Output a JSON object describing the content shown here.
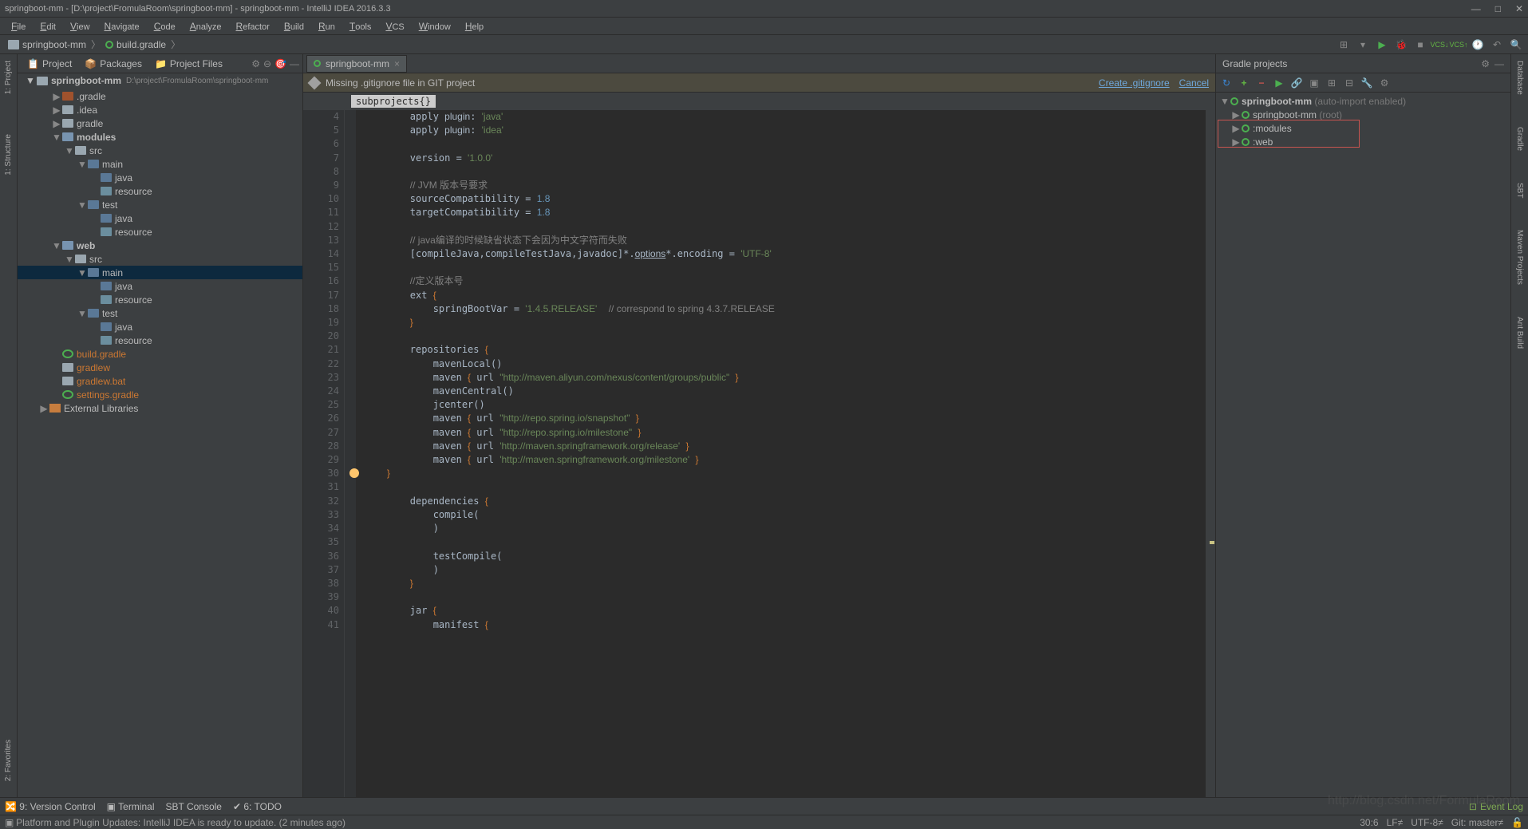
{
  "titlebar": "springboot-mm - [D:\\project\\FromulaRoom\\springboot-mm] - springboot-mm - IntelliJ IDEA 2016.3.3",
  "menu": [
    "File",
    "Edit",
    "View",
    "Navigate",
    "Code",
    "Analyze",
    "Refactor",
    "Build",
    "Run",
    "Tools",
    "VCS",
    "Window",
    "Help"
  ],
  "breadcrumb": {
    "proj": "springboot-mm",
    "file": "build.gradle"
  },
  "panelTabs": [
    "Project",
    "Packages",
    "Project Files"
  ],
  "projHeader": {
    "name": "springboot-mm",
    "path": "D:\\project\\FromulaRoom\\springboot-mm"
  },
  "tree": [
    {
      "d": 1,
      "c": "▶",
      "t": "excl",
      "l": ".gradle"
    },
    {
      "d": 1,
      "c": "▶",
      "t": "folder",
      "l": ".idea"
    },
    {
      "d": 1,
      "c": "▶",
      "t": "folder",
      "l": "gradle"
    },
    {
      "d": 1,
      "c": "▼",
      "t": "modfolder",
      "l": "modules",
      "b": true
    },
    {
      "d": 2,
      "c": "▼",
      "t": "folder",
      "l": "src"
    },
    {
      "d": 3,
      "c": "▼",
      "t": "srcfolder",
      "l": "main"
    },
    {
      "d": 4,
      "c": "",
      "t": "srcfolder",
      "l": "java"
    },
    {
      "d": 4,
      "c": "",
      "t": "resfolder",
      "l": "resource"
    },
    {
      "d": 3,
      "c": "▼",
      "t": "srcfolder",
      "l": "test"
    },
    {
      "d": 4,
      "c": "",
      "t": "srcfolder",
      "l": "java"
    },
    {
      "d": 4,
      "c": "",
      "t": "resfolder",
      "l": "resource"
    },
    {
      "d": 1,
      "c": "▼",
      "t": "modfolder",
      "l": "web",
      "b": true
    },
    {
      "d": 2,
      "c": "▼",
      "t": "folder",
      "l": "src"
    },
    {
      "d": 3,
      "c": "▼",
      "t": "srcfolder",
      "l": "main",
      "sel": true
    },
    {
      "d": 4,
      "c": "",
      "t": "srcfolder",
      "l": "java"
    },
    {
      "d": 4,
      "c": "",
      "t": "resfolder",
      "l": "resource"
    },
    {
      "d": 3,
      "c": "▼",
      "t": "srcfolder",
      "l": "test"
    },
    {
      "d": 4,
      "c": "",
      "t": "srcfolder",
      "l": "java"
    },
    {
      "d": 4,
      "c": "",
      "t": "resfolder",
      "l": "resource"
    },
    {
      "d": 1,
      "c": "",
      "t": "gradleico",
      "l": "build.gradle",
      "orange": true
    },
    {
      "d": 1,
      "c": "",
      "t": "fileico",
      "l": "gradlew",
      "orange": true
    },
    {
      "d": 1,
      "c": "",
      "t": "fileico",
      "l": "gradlew.bat",
      "orange": true
    },
    {
      "d": 1,
      "c": "",
      "t": "gradleico",
      "l": "settings.gradle",
      "orange": true
    },
    {
      "d": 0,
      "c": "▶",
      "t": "lib",
      "l": "External Libraries"
    }
  ],
  "editorTab": "springboot-mm",
  "banner": {
    "msg": "Missing .gitignore file in GIT project",
    "link1": "Create .gitignore",
    "link2": "Cancel"
  },
  "crumb": "subprojects{}",
  "lines": [
    {
      "n": 4,
      "h": "        apply <span class='id'>plugin</span>: <span class='str'>'java'</span>"
    },
    {
      "n": 5,
      "h": "        apply <span class='id'>plugin</span>: <span class='str'>'idea'</span>"
    },
    {
      "n": 6,
      "h": ""
    },
    {
      "n": 7,
      "h": "        version = <span class='str'>'1.0.0'</span>"
    },
    {
      "n": 8,
      "h": ""
    },
    {
      "n": 9,
      "h": "        <span class='cmt'>// JVM 版本号要求</span>"
    },
    {
      "n": 10,
      "h": "        sourceCompatibility = <span class='num'>1.8</span>"
    },
    {
      "n": 11,
      "h": "        targetCompatibility = <span class='num'>1.8</span>"
    },
    {
      "n": 12,
      "h": ""
    },
    {
      "n": 13,
      "h": "        <span class='cmt'>// java编译的时候缺省状态下会因为中文字符而失败</span>"
    },
    {
      "n": 14,
      "h": "        [compileJava,compileTestJava,javadoc]*.<span class='ul'>options</span>*.encoding = <span class='str'>'UTF-8'</span>"
    },
    {
      "n": 15,
      "h": ""
    },
    {
      "n": 16,
      "h": "        <span class='cmt'>//定义版本号</span>"
    },
    {
      "n": 17,
      "h": "        ext <span class='kw'>{</span>"
    },
    {
      "n": 18,
      "h": "            springBootVar = <span class='str'>'1.4.5.RELEASE'</span>  <span class='cmt'>// correspond to spring 4.3.7.RELEASE</span>"
    },
    {
      "n": 19,
      "h": "        <span class='kw'>}</span>"
    },
    {
      "n": 20,
      "h": ""
    },
    {
      "n": 21,
      "h": "        repositories <span class='kw'>{</span>"
    },
    {
      "n": 22,
      "h": "            mavenLocal()"
    },
    {
      "n": 23,
      "h": "            maven <span class='kw'>{</span> url <span class='str'>\"http://maven.aliyun.com/nexus/content/groups/public\"</span> <span class='kw'>}</span>"
    },
    {
      "n": 24,
      "h": "            mavenCentral()"
    },
    {
      "n": 25,
      "h": "            jcenter()"
    },
    {
      "n": 26,
      "h": "            maven <span class='kw'>{</span> url <span class='str'>\"http://repo.spring.io/snapshot\"</span> <span class='kw'>}</span>"
    },
    {
      "n": 27,
      "h": "            maven <span class='kw'>{</span> url <span class='str'>\"http://repo.spring.io/milestone\"</span> <span class='kw'>}</span>"
    },
    {
      "n": 28,
      "h": "            maven <span class='kw'>{</span> url <span class='str'>'http://maven.springframework.org/release'</span> <span class='kw'>}</span>"
    },
    {
      "n": 29,
      "h": "            maven <span class='kw'>{</span> url <span class='str'>'http://maven.springframework.org/milestone'</span> <span class='kw'>}</span>"
    },
    {
      "n": 30,
      "h": "    <span class='kw'>}</span>"
    },
    {
      "n": 31,
      "h": ""
    },
    {
      "n": 32,
      "h": "        dependencies <span class='kw'>{</span>"
    },
    {
      "n": 33,
      "h": "            compile("
    },
    {
      "n": 34,
      "h": "            )"
    },
    {
      "n": 35,
      "h": ""
    },
    {
      "n": 36,
      "h": "            testCompile("
    },
    {
      "n": 37,
      "h": "            )"
    },
    {
      "n": 38,
      "h": "        <span class='kw'>}</span>"
    },
    {
      "n": 39,
      "h": ""
    },
    {
      "n": 40,
      "h": "        jar <span class='kw'>{</span>"
    },
    {
      "n": 41,
      "h": "            manifest <span class='kw'>{</span>"
    }
  ],
  "leftRail": [
    "1: Project",
    "1: Structure",
    "2: Favorites"
  ],
  "rightRail": [
    "Database",
    "Gradle",
    "SBT",
    "Maven Projects",
    "Ant Build"
  ],
  "gradle": {
    "title": "Gradle projects",
    "root": "springboot-mm",
    "rootNote": "(auto-import enabled)",
    "items": [
      {
        "l": "springboot-mm",
        "note": "(root)"
      },
      {
        "l": ":modules"
      },
      {
        "l": ":web"
      }
    ]
  },
  "bottomTool": [
    "9: Version Control",
    "Terminal",
    "SBT Console",
    "6: TODO"
  ],
  "eventLog": "Event Log",
  "status": {
    "msg": "Platform and Plugin Updates: IntelliJ IDEA is ready to update. (2 minutes ago)",
    "pos": "30:6",
    "lf": "LF≠",
    "enc": "UTF-8≠",
    "git": "Git: master≠",
    "lock": "🔓"
  },
  "watermark": "http://blog.csdn.net/FormulaRoom"
}
